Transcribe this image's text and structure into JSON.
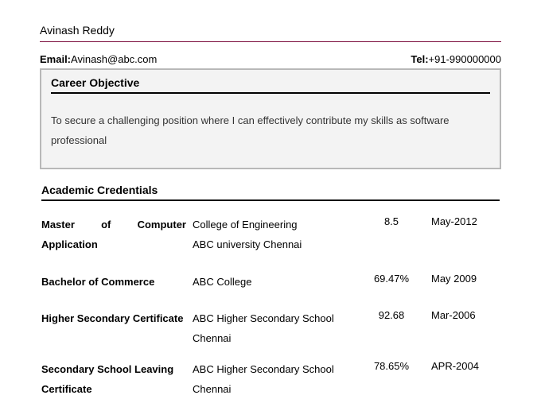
{
  "name": "Avinash Reddy",
  "contact": {
    "email_label": "Email:",
    "email_value": "Avinash@abc.com",
    "tel_label": "Tel:",
    "tel_value": "+91-990000000"
  },
  "objective": {
    "header": "Career Objective",
    "text": "To secure a challenging position where I can effectively contribute my skills as software professional"
  },
  "academic": {
    "header": "Academic Credentials",
    "rows": [
      {
        "degree_line1": "Master of Computer",
        "degree_line2": "Application",
        "inst_line1": "College of Engineering",
        "inst_line2": "ABC university Chennai",
        "score": "8.5",
        "date": "May-2012"
      },
      {
        "degree_line1": "Bachelor of Commerce",
        "degree_line2": "",
        "inst_line1": "ABC College",
        "inst_line2": "",
        "score": "69.47%",
        "date": "May 2009"
      },
      {
        "degree_line1": "Higher Secondary Certificate",
        "degree_line2": "",
        "inst_line1": "ABC Higher Secondary School",
        "inst_line2": "Chennai",
        "score": "92.68",
        "date": "Mar-2006"
      },
      {
        "degree_line1": "Secondary School Leaving",
        "degree_line2": "Certificate",
        "inst_line1": "ABC Higher Secondary School",
        "inst_line2": "Chennai",
        "score": "78.65%",
        "date": "APR-2004"
      }
    ]
  }
}
